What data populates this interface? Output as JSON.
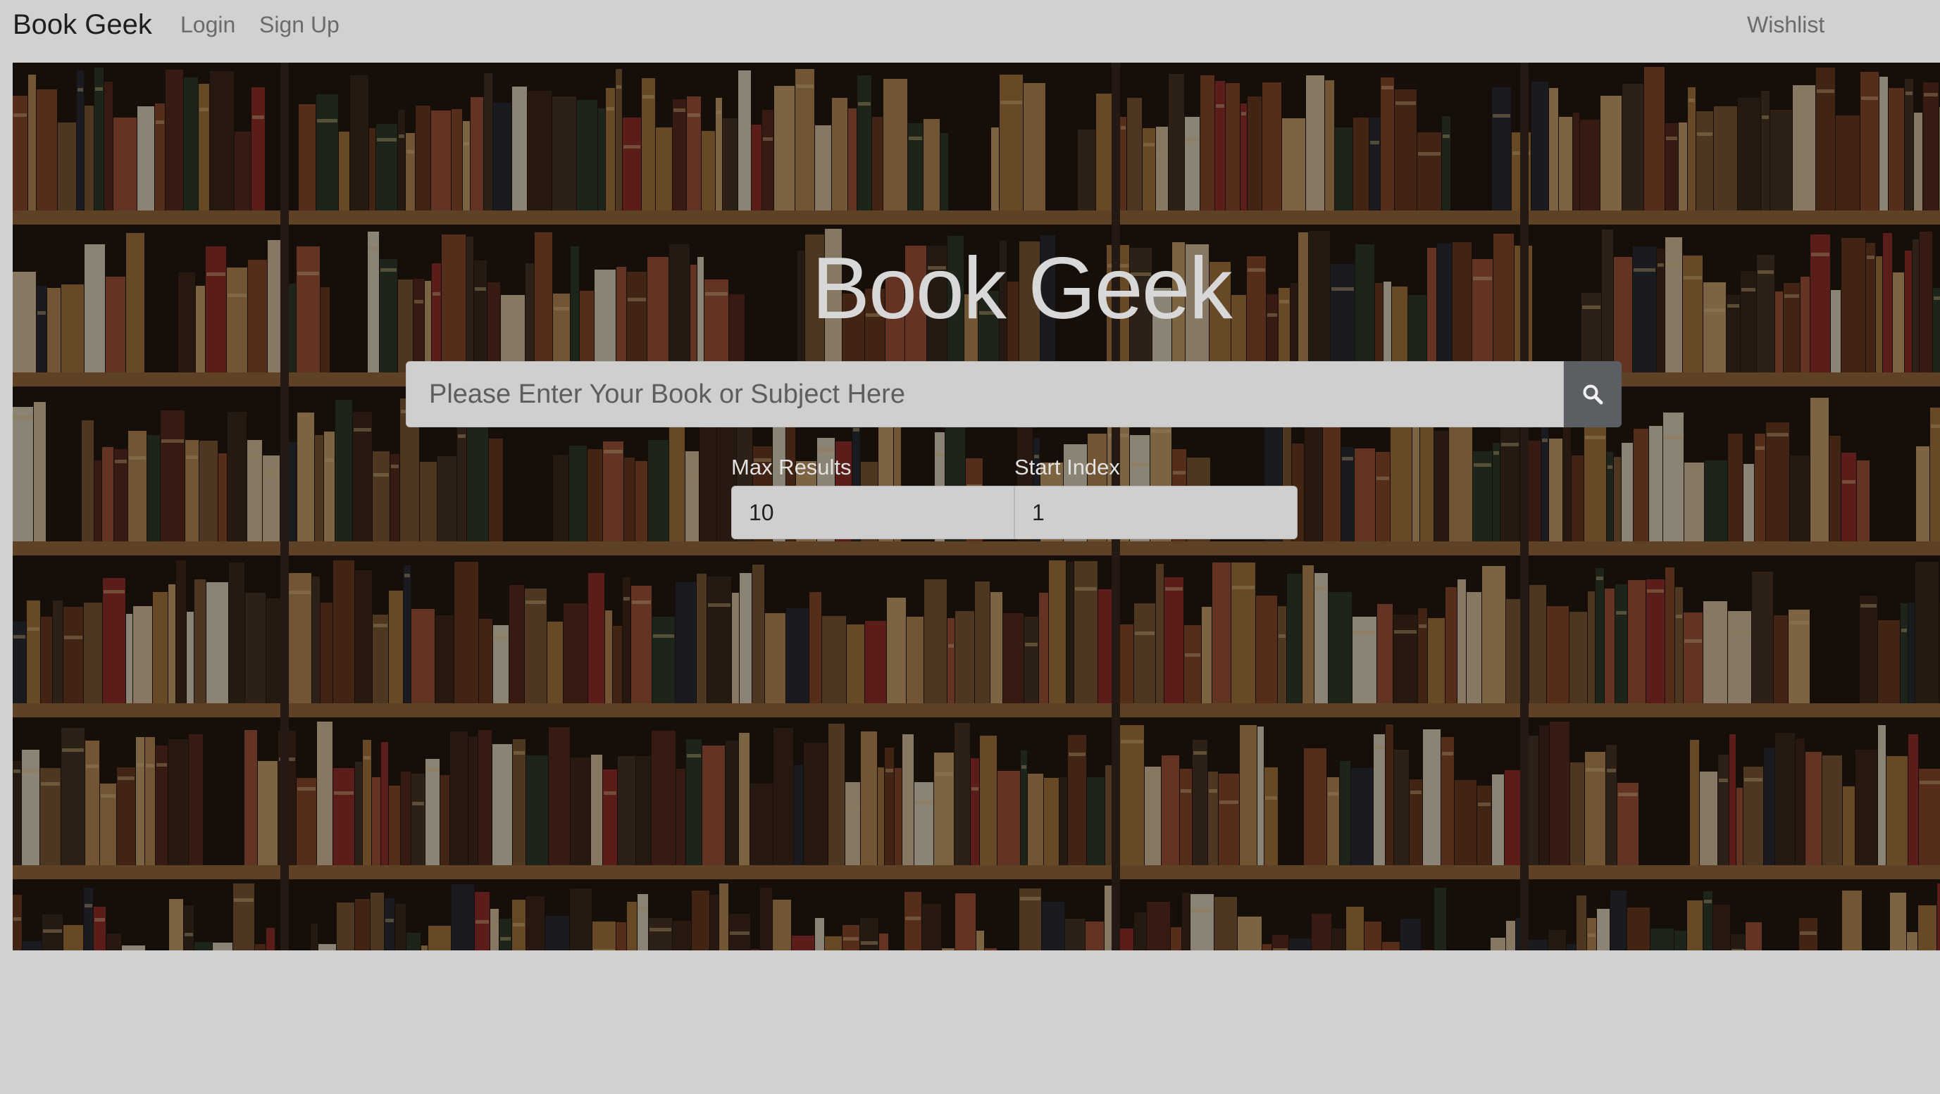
{
  "navbar": {
    "brand": "Book Geek",
    "links": {
      "login": "Login",
      "signup": "Sign Up",
      "wishlist": "Wishlist"
    }
  },
  "hero": {
    "title": "Book Geek",
    "background_description_icon": "bookshelf-background",
    "search": {
      "placeholder": "Please Enter Your Book or Subject Here",
      "value": "",
      "button_icon": "search-icon"
    },
    "max_results": {
      "label": "Max Results",
      "value": "10"
    },
    "start_index": {
      "label": "Start Index",
      "value": "1"
    }
  },
  "colors": {
    "page_background": "#d1d1d1",
    "search_button": "#5b5e62",
    "title_text": "#d8d8d8"
  }
}
